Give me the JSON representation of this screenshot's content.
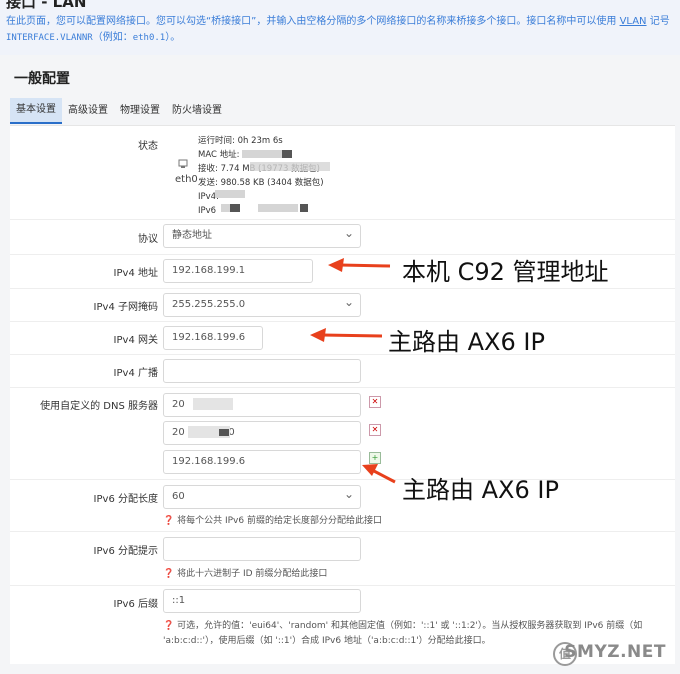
{
  "header": {
    "title": "接口 - LAN",
    "description_line1": "在此页面，您可以配置网络接口。您可以勾选“桥接接口”，并输入由空格分隔的多个网络接口的名称来桥接多个接口。接口名称中可以使用",
    "vlan_link": "VLAN",
    "description_tail": "记号",
    "description_line2_mono": "INTERFACE.VLANNR",
    "description_line2_text": "（例如：",
    "description_line2_example": "eth0.1",
    "description_line2_end": "）。"
  },
  "section": {
    "title": "一般配置"
  },
  "tabs": [
    {
      "label": "基本设置",
      "active": true
    },
    {
      "label": "高级设置",
      "active": false
    },
    {
      "label": "物理设置",
      "active": false
    },
    {
      "label": "防火墙设置",
      "active": false
    }
  ],
  "status": {
    "label": "状态",
    "device": "eth0",
    "uptime": "运行时间: 0h 23m 6s",
    "mac": "MAC 地址:",
    "rx": "接收: 7.74 MB (19773 数据包)",
    "tx": "发送: 980.58 KB (3404 数据包)",
    "ipv4": "IPv4:",
    "ipv6": "IPv6"
  },
  "protocol": {
    "label": "协议",
    "value": "静态地址"
  },
  "ipv4_addr": {
    "label": "IPv4 地址",
    "value": "192.168.199.1"
  },
  "netmask": {
    "label": "IPv4 子网掩码",
    "value": "255.255.255.0"
  },
  "gateway": {
    "label": "IPv4 网关",
    "value": "192.168.199.6"
  },
  "broadcast": {
    "label": "IPv4 广播",
    "value": ""
  },
  "dns": {
    "label": "使用自定义的 DNS 服务器",
    "entries": [
      "20",
      "20",
      "192.168.199.6"
    ],
    "entry1_tail": "58",
    "entry2_tail": "50"
  },
  "ipv6_len": {
    "label": "IPv6 分配长度",
    "value": "60",
    "hint": "将每个公共 IPv6 前缀的给定长度部分分配给此接口"
  },
  "ipv6_hint": {
    "label": "IPv6 分配提示",
    "value": "",
    "hint": "将此十六进制子 ID 前缀分配给此接口"
  },
  "ipv6_suffix": {
    "label": "IPv6 后缀",
    "value": "::1",
    "hint_line1": "可选，允许的值：'eui64'、'random' 和其他固定值（例如：'::1' 或 '::1:2'）。当从授权服务器获取到 IPv6 前缀（如",
    "hint_line2": "'a:b:c:d::'），使用后缀（如 '::1'）合成 IPv6 地址（'a:b:c:d::1'）分配给此接口。"
  },
  "annotations": {
    "mgmt": "本机 C92 管理地址",
    "gateway": "主路由 AX6 IP",
    "dns": "主路由 AX6 IP"
  },
  "watermark": {
    "text": "SMYZ.NET",
    "icon": "值"
  },
  "colors": {
    "annotation_arrow": "#e8401c",
    "link": "#3a7dd8",
    "tab_active": "#d6e4f5"
  }
}
